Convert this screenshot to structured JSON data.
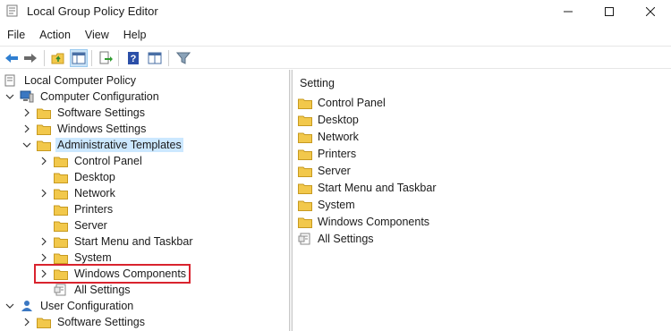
{
  "window": {
    "title": "Local Group Policy Editor"
  },
  "menu": [
    "File",
    "Action",
    "View",
    "Help"
  ],
  "toolbar": {
    "buttons": [
      "back-icon",
      "forward-icon",
      "up-folder-icon",
      "show-hide-tree-icon",
      "export-list-icon",
      "help-icon",
      "properties-view-icon",
      "filter-icon"
    ]
  },
  "tree": {
    "root": "Local Computer Policy",
    "computer_config": "Computer Configuration",
    "software_settings": "Software Settings",
    "windows_settings": "Windows Settings",
    "admin_templates": "Administrative Templates",
    "control_panel": "Control Panel",
    "desktop": "Desktop",
    "network": "Network",
    "printers": "Printers",
    "server": "Server",
    "start_menu": "Start Menu and Taskbar",
    "system": "System",
    "windows_components": "Windows Components",
    "all_settings": "All Settings",
    "user_config": "User Configuration",
    "user_software_settings": "Software Settings"
  },
  "details": {
    "column_header": "Setting",
    "items": [
      "Control Panel",
      "Desktop",
      "Network",
      "Printers",
      "Server",
      "Start Menu and Taskbar",
      "System",
      "Windows Components",
      "All Settings"
    ]
  },
  "colors": {
    "folder": "#f2c84b",
    "selection": "#cce8ff",
    "highlight_box": "#d9232e"
  }
}
